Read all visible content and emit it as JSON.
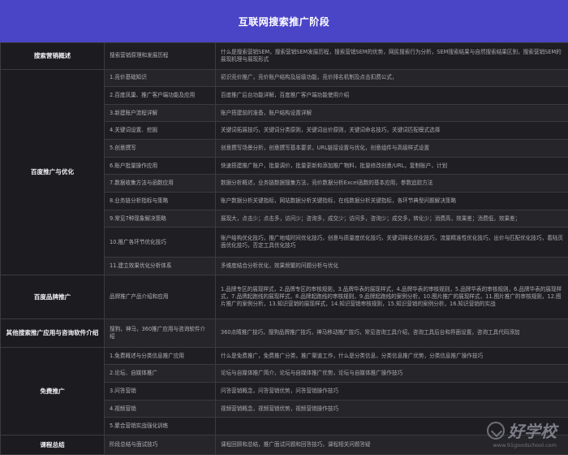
{
  "banner": {
    "title": "互联网搜索推广阶段"
  },
  "rows": [
    {
      "cat": "搜索营销概述",
      "rowspan": 1,
      "sub": "搜索营销原理和发展历程",
      "desc": "什么是搜索营销SEM，搜索营销SEM发展历程，搜索营销SEM的优势，网民搜索行为分析，SEM搜索结果与自然搜索结果区别，搜索营销SEM的展现机理与展现形式"
    },
    {
      "cat": "百度推广与优化",
      "rowspan": 11,
      "sub": "1.竞价基础知识",
      "desc": "初识竞价推广，竞价账户结构及层级功能，竞价排名机制及点击扣费公式，"
    },
    {
      "sub": "2.百度凤巢、推广客户端功能及应用",
      "desc": "百度推广后台功能详解，百度推广客户端功能使用介绍"
    },
    {
      "sub": "3.新建账户流程详解",
      "desc": "账户搭建前的准备，账户结构设置详解"
    },
    {
      "sub": "4.关键词设置、挖掘",
      "desc": "关键词拓展技巧，关键词分类原则，关键词出价原则，关键词命名技巧，关键词匹配模式选择"
    },
    {
      "sub": "5.创意撰写",
      "desc": "创意撰写场景分析，创意撰写基本要求，URL链接设置与优化，创意组件与高级样式设置"
    },
    {
      "sub": "6.账户批量操作应用",
      "desc": "快速搭建推广账户，批量调价，批量更新和添加推广物料，批量修改创意/URL，复制账户，计划"
    },
    {
      "sub": "7.数据收集方法与函数应用",
      "desc": "数据分析概述，业务链数据搜集方法，竞价数据分析Excel函数的基本应用，参数追踪方法"
    },
    {
      "sub": "8.业务链分析指标与策略",
      "desc": "账户数据分析关键指标，网站数据分析关键指标，在线数据分析关键指标，各环节典型问题解决策略"
    },
    {
      "sub": "9.常见7种现象解决策略",
      "desc": "展现大，点击少；点击多，访问少；咨询多，成交少；访问多，咨询少；成交多，转化少；消费高，效果差；消费低，效果差；"
    },
    {
      "sub": "10.推广各环节优化技巧",
      "desc": "账户结构优化技巧，推广地域时间优化技巧，创意与质量度优化技巧，关键词排名优化技巧，流量精准性优化技巧，出价与匹配优化技巧，着陆页面优化技巧，否定工具优化技巧"
    },
    {
      "sub": "11.建立效果优化分析体系",
      "desc": "多维度结合分析优化，效果频繁的问题分析与优化"
    },
    {
      "cat": "百度品牌推广",
      "rowspan": 1,
      "sub": "品牌推广产品介绍和应用",
      "desc": "1.品牌专区的展现样式，2.品牌专区的审核规则，3.品牌华表的展现样式，4.品牌华表的审核规则，5.品牌华表的审核规则，6.品牌华表的展现样式，7.品牌起跑线的展现样式，8.品牌起跑线的审核规则，9.品牌起跑线的案例分析，10.图片推广的展现样式，11.图片推广的审核规则，12.图片推广的案例分析，13.知识营销的展现样式，14.知识营销审核规则，15.知识营销的案例分析，16.知识营销的实战"
    },
    {
      "cat": "其他搜索推广应用与咨询软件介绍",
      "rowspan": 1,
      "sub": "搜狗，神马，360推广应用与咨询软件介绍",
      "desc": "360点睛推广技巧，搜狗品牌推广技巧，神马移动推广技巧，常见咨询工具介绍，咨询工具后台和界面设置，咨询工具代码添加"
    },
    {
      "cat": "免费推广",
      "rowspan": 5,
      "sub": "1.免费概述与分类信息推广应用",
      "desc": "什么是免费推广，免费推广分类，推广渠道工作，什么是分类信息，分类信息推广优势，分类信息推广操作技巧"
    },
    {
      "sub": "2.论坛、自媒体推广",
      "desc": "论坛与自媒体推广简介，论坛与自媒体推广优势，论坛与自媒体推广操作技巧"
    },
    {
      "sub": "3.问答营销",
      "desc": "问答营销概念，问答营销优势，问答营销操作技巧"
    },
    {
      "sub": "4.视频营销",
      "desc": "视频营销概念，视频营销优势，视频营销操作技巧"
    },
    {
      "sub": "5.聚合营销实战强化训练",
      "desc": ""
    },
    {
      "cat": "课程总结",
      "rowspan": 1,
      "sub": "阶段总结与面试技巧",
      "desc": "课程回顾和总结，推广面试问题和回答技巧，课程相关问题答疑"
    }
  ],
  "watermark": {
    "text": "好学校",
    "url": "www.91goodschool.com"
  }
}
